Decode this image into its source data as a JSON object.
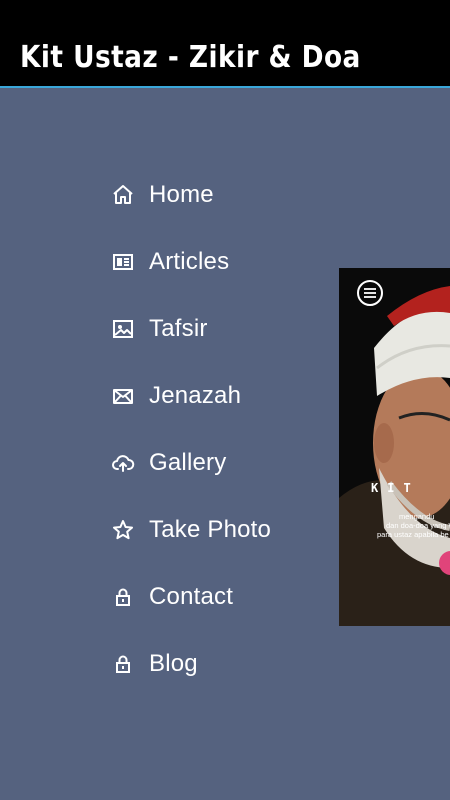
{
  "app": {
    "title": "Kit Ustaz - Zikir & Doa"
  },
  "menu": {
    "items": [
      {
        "label": "Home",
        "icon": "home-icon"
      },
      {
        "label": "Articles",
        "icon": "newspaper-icon"
      },
      {
        "label": "Tafsir",
        "icon": "image-icon"
      },
      {
        "label": "Jenazah",
        "icon": "mail-icon"
      },
      {
        "label": "Gallery",
        "icon": "cloud-upload-icon"
      },
      {
        "label": "Take Photo",
        "icon": "star-icon"
      },
      {
        "label": "Contact",
        "icon": "lock-icon"
      },
      {
        "label": "Blog",
        "icon": "lock-icon"
      }
    ]
  },
  "preview": {
    "brand": "KIT",
    "line1": "mengandu",
    "line2": "dan doa-doa yang W",
    "line3": "para ustaz apabila be"
  },
  "colors": {
    "background": "#55627f",
    "app_bar": "#000000",
    "accent_line": "#3aa7d9",
    "fab": "#e0447a"
  }
}
